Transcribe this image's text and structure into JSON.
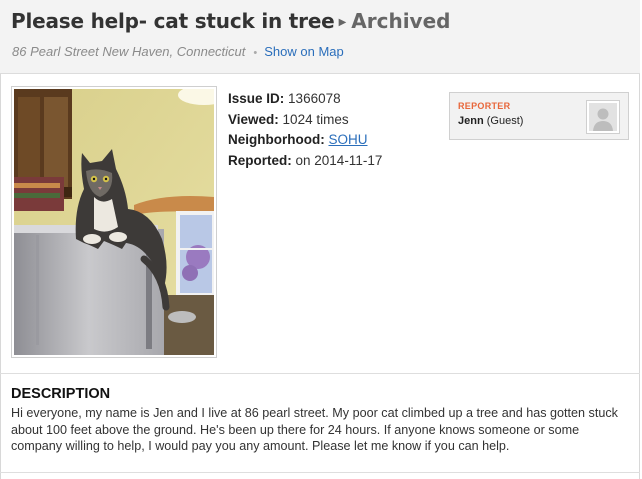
{
  "issue": {
    "title": "Please help- cat stuck in tree",
    "status": "Archived",
    "address": "86 Pearl Street New Haven, Connecticut",
    "map_link": "Show on Map"
  },
  "details": {
    "id_label": "Issue ID:",
    "id_value": "1366078",
    "viewed_label": "Viewed:",
    "viewed_value": "1024 times",
    "neighborhood_label": "Neighborhood:",
    "neighborhood_value": "SOHU",
    "reported_label": "Reported:",
    "reported_value": "on 2014-11-17"
  },
  "reporter": {
    "heading": "REPORTER",
    "name": "Jenn",
    "role": "(Guest)"
  },
  "description": {
    "heading": "DESCRIPTION",
    "body": "Hi everyone, my name is Jen and I live at 86 pearl street. My poor cat climbed up a tree and has gotten stuck about 100 feet above the ground. He's been up there for 24 hours. If anyone knows someone or some company willing to help, I would pay you any amount. Please let me know if you can help."
  }
}
